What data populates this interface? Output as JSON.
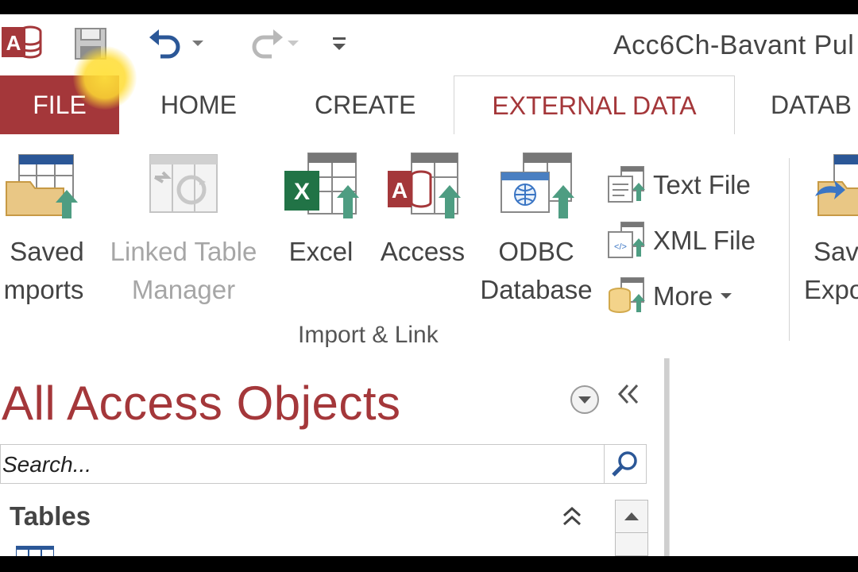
{
  "window": {
    "title": "Acc6Ch-Bavant Pul"
  },
  "colors": {
    "accent": "#a4373a",
    "file_tab_bg": "#a4373a",
    "excel_green": "#217346",
    "text": "#444444",
    "disabled_text": "#a6a6a6"
  },
  "quick_access": {
    "icons": [
      "access-logo-icon",
      "save-icon",
      "undo-icon",
      "redo-icon",
      "customize-qat-icon"
    ]
  },
  "tabs": [
    {
      "label": "FILE"
    },
    {
      "label": "HOME"
    },
    {
      "label": "CREATE"
    },
    {
      "label": "EXTERNAL DATA",
      "active": true
    },
    {
      "label": "DATAB"
    }
  ],
  "ribbon": {
    "saved_imports": {
      "line1": "Saved",
      "line2": "mports"
    },
    "linked_table_manager": {
      "line1": "Linked Table",
      "line2": "Manager"
    },
    "excel": {
      "label": "Excel"
    },
    "access": {
      "label": "Access"
    },
    "odbc": {
      "line1": "ODBC",
      "line2": "Database"
    },
    "text_file": {
      "label": "Text File"
    },
    "xml_file": {
      "label": "XML File"
    },
    "more": {
      "label": "More"
    },
    "saved_exports": {
      "line1": "Save",
      "line2": "Expo"
    },
    "group_label": "Import & Link"
  },
  "nav_pane": {
    "title": "All Access Objects",
    "search_placeholder": "Search...",
    "section": "Tables"
  }
}
